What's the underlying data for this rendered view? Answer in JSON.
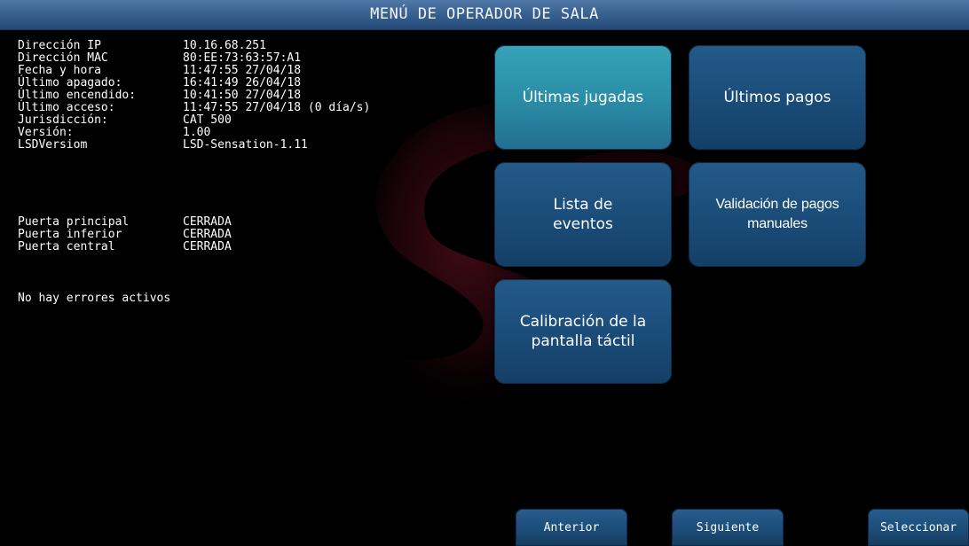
{
  "title": "MENÚ DE OPERADOR DE SALA",
  "info": {
    "system": [
      {
        "label": "Dirección IP",
        "value": "10.16.68.251"
      },
      {
        "label": "Dirección MAC",
        "value": "80:EE:73:63:57:A1"
      },
      {
        "label": "Fecha y hora",
        "value": "11:47:55 27/04/18"
      },
      {
        "label": "Último apagado:",
        "value": "16:41:49 26/04/18"
      },
      {
        "label": "Último encendido:",
        "value": "10:41:50 27/04/18"
      },
      {
        "label": "Último acceso:",
        "value": "11:47:55 27/04/18 (0 día/s)"
      },
      {
        "label": "Jurisdicción:",
        "value": "CAT 500"
      },
      {
        "label": "Versión:",
        "value": "1.00"
      },
      {
        "label": "LSDVersiom",
        "value": "LSD-Sensation-1.11"
      }
    ],
    "doors": [
      {
        "label": "Puerta principal",
        "value": "CERRADA"
      },
      {
        "label": "Puerta inferior",
        "value": "CERRADA"
      },
      {
        "label": "Puerta central",
        "value": "CERRADA"
      }
    ],
    "errors": "No hay errores activos"
  },
  "menu": {
    "items": [
      {
        "label": "Últimas jugadas",
        "selected": true
      },
      {
        "label": "Últimos pagos",
        "selected": false
      },
      {
        "label": "Lista de\neventos",
        "selected": false
      },
      {
        "label": "Validación de pagos\nmanuales",
        "selected": false
      },
      {
        "label": "Calibración de la\npantalla táctil",
        "selected": false
      }
    ]
  },
  "nav": {
    "prev_label": "Anterior",
    "next_label": "Siguiente",
    "select_label": "Seleccionar"
  },
  "colors": {
    "title_bar": "#3a6291",
    "tile": "#1b4d7a",
    "tile_selected": "#2b8ea7",
    "emblem": "#5a0d1c"
  }
}
